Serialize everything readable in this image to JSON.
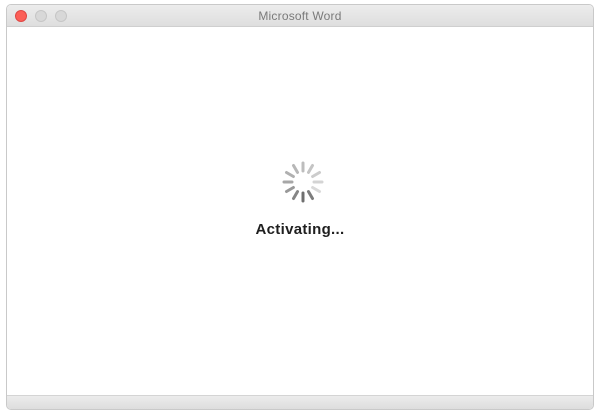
{
  "window": {
    "title": "Microsoft Word"
  },
  "status": {
    "message": "Activating..."
  },
  "icons": {
    "spinner": "loading-spinner-icon"
  },
  "colors": {
    "close_button": "#fc5f57",
    "inactive_button": "#d8d8d8"
  }
}
